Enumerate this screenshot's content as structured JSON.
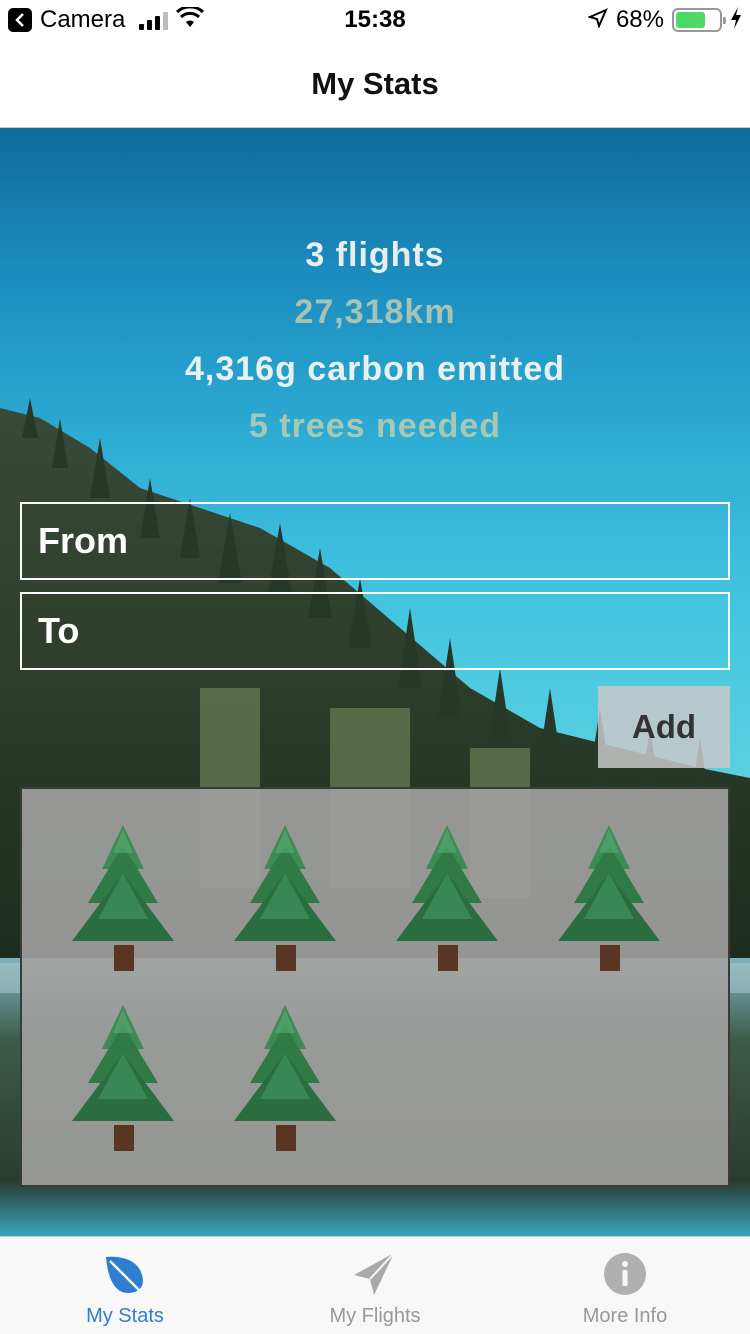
{
  "status_bar": {
    "back_app": "Camera",
    "time": "15:38",
    "battery_pct": "68%",
    "battery_level": 0.68,
    "icons": [
      "back-arrow-icon",
      "signal-icon",
      "wifi-icon",
      "location-arrow-icon",
      "battery-icon",
      "charging-bolt-icon"
    ]
  },
  "nav": {
    "title": "My Stats"
  },
  "stats": {
    "flights": "3 flights",
    "distance": "27,318km",
    "carbon": "4,316g carbon emitted",
    "trees": "5 trees needed"
  },
  "form": {
    "from_placeholder": "From",
    "to_placeholder": "To",
    "add_label": "Add"
  },
  "trees_panel": {
    "tree_count": 6,
    "tree_icon": "evergreen-tree-icon"
  },
  "tab_bar": {
    "tabs": [
      {
        "label": "My Stats",
        "icon": "leaf-icon",
        "active": true
      },
      {
        "label": "My Flights",
        "icon": "paper-plane-icon",
        "active": false
      },
      {
        "label": "More Info",
        "icon": "info-icon",
        "active": false
      }
    ]
  },
  "colors": {
    "accent": "#2f7dd1",
    "battery_fill": "#4cd964",
    "tree_green": "#2f7a45",
    "trunk_brown": "#5a3522"
  }
}
